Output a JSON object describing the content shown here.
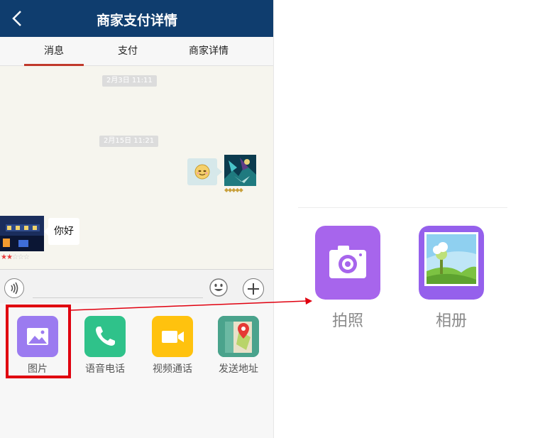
{
  "header": {
    "title": "商家支付详情",
    "back_icon": "chevron-left-icon"
  },
  "tabs": [
    {
      "label": "消息",
      "active": true
    },
    {
      "label": "支付",
      "active": false
    },
    {
      "label": "商家详情",
      "active": false
    }
  ],
  "chat": {
    "timestamps": [
      "2月3日 11:11",
      "2月15日 11:21"
    ],
    "messages": [
      {
        "side": "right",
        "content": "emoji-smile",
        "rating": "◆◆◆◆◆"
      },
      {
        "side": "left",
        "text": "你好",
        "rating_on": "★★",
        "rating_off": "☆☆☆"
      }
    ]
  },
  "input_bar": {
    "placeholder": "",
    "voice_icon": "voice-icon",
    "emoji_icon": "smiley-icon",
    "plus_icon": "plus-icon"
  },
  "tools": [
    {
      "label": "图片",
      "icon": "image-icon",
      "color": "#9b7bf0"
    },
    {
      "label": "语音电话",
      "icon": "phone-icon",
      "color": "#2fc28a"
    },
    {
      "label": "视频通话",
      "icon": "video-icon",
      "color": "#ffc20e"
    },
    {
      "label": "发送地址",
      "icon": "map-pin-icon",
      "color": "#4aa38c"
    }
  ],
  "detail_options": [
    {
      "label": "拍照",
      "icon": "camera-icon",
      "color": "#a765ec"
    },
    {
      "label": "相册",
      "icon": "album-icon",
      "color": "#9560ec"
    }
  ],
  "colors": {
    "titlebar": "#0f3d6e",
    "highlight": "#e0000f",
    "tab_underline": "#c0392b",
    "chat_bg": "#f6f5ee"
  }
}
